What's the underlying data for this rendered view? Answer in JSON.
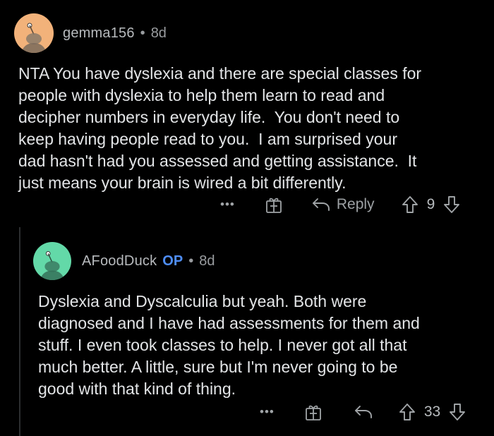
{
  "colors": {
    "background": "#000000",
    "op_badge": "#4f8ef7",
    "avatar1_bg": "#f2b27a",
    "avatar2_bg": "#63d9a8"
  },
  "comments": [
    {
      "username": "gemma156",
      "separator": "•",
      "age": "8d",
      "avatar_icon": "snoo-avatar-icon",
      "body": "NTA You have dyslexia and there are special classes for\npeople with dyslexia to help them learn to read and\ndecipher numbers in everyday life.  You don't need to\nkeep having people read to you.  I am surprised your\ndad hasn't had you assessed and getting assistance.  It\njust means your brain is wired a bit differently.",
      "actions": {
        "more_label": "•••",
        "award_icon": "gift-icon",
        "reply_icon": "reply-arrow-icon",
        "reply_label": "Reply",
        "upvote_icon": "upvote-arrow-icon",
        "score": "9",
        "downvote_icon": "downvote-arrow-icon"
      }
    },
    {
      "username": "AFoodDuck",
      "op_label": "OP",
      "separator": "•",
      "age": "8d",
      "avatar_icon": "snoo-avatar-icon",
      "body": "Dyslexia and Dyscalculia but yeah. Both were\ndiagnosed and I have had assessments for them and\nstuff. I even took classes to help. I never got all that\nmuch better. A little, sure but I'm never going to be\ngood with that kind of thing.",
      "actions": {
        "more_label": "•••",
        "award_icon": "gift-icon",
        "reply_icon": "reply-arrow-icon",
        "upvote_icon": "upvote-arrow-icon",
        "score": "33",
        "downvote_icon": "downvote-arrow-icon"
      }
    }
  ]
}
